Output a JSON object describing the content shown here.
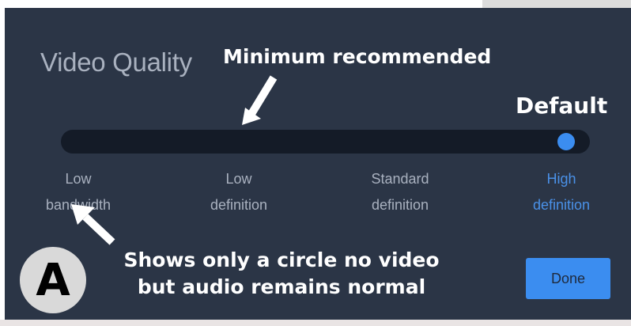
{
  "dialog": {
    "title": "Video Quality",
    "done_label": "Done",
    "slider": {
      "selected_index": 3,
      "options": [
        {
          "line1": "Low",
          "line2": "bandwidth"
        },
        {
          "line1": "Low",
          "line2": "definition"
        },
        {
          "line1": "Standard",
          "line2": "definition"
        },
        {
          "line1": "High",
          "line2": "definition"
        }
      ]
    }
  },
  "annotations": {
    "minimum": "Minimum recommended",
    "default": "Default",
    "circle_line1": "Shows only a circle no video",
    "circle_line2": "but audio remains normal",
    "badge": "A"
  },
  "colors": {
    "dialog_bg": "#2b3546",
    "track": "#141b27",
    "accent": "#3b8df0",
    "label": "#a9b1bf",
    "active_label": "#4a91e8"
  }
}
